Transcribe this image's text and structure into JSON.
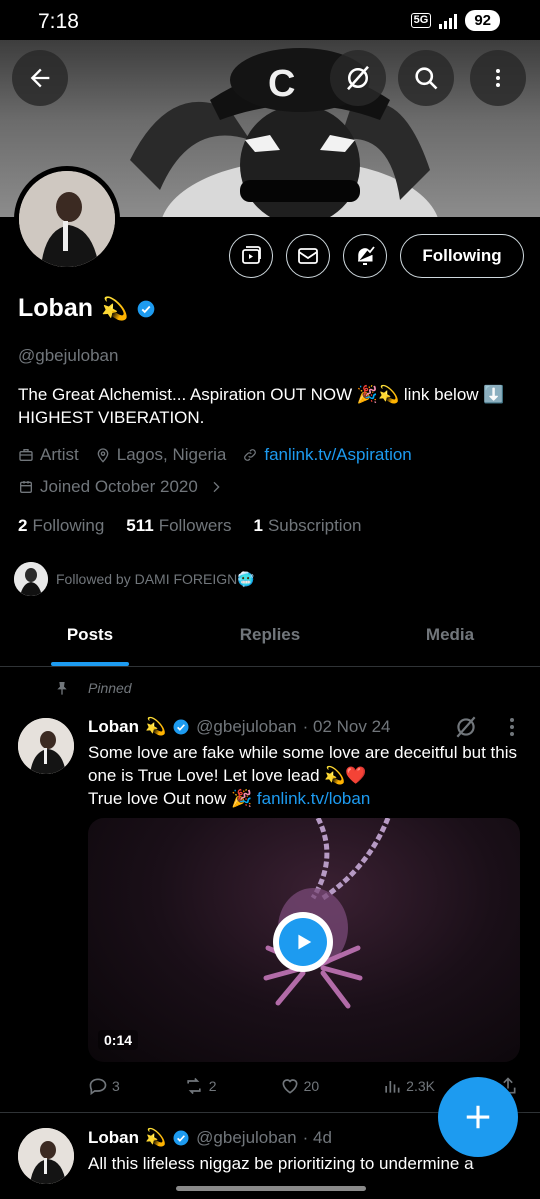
{
  "status": {
    "time": "7:18",
    "network": "5G",
    "battery": "92"
  },
  "profile": {
    "name": "Loban",
    "name_emoji": "💫",
    "handle": "@gbejuloban",
    "bio": "The Great Alchemist... Aspiration OUT NOW 🎉💫 link below ⬇️ HIGHEST VIBERATION.",
    "category": "Artist",
    "location": "Lagos, Nigeria",
    "link": "fanlink.tv/Aspiration",
    "joined": "Joined October 2020",
    "following_count": "2",
    "following_label": "Following",
    "followers_count": "511",
    "followers_label": "Followers",
    "subscription_count": "1",
    "subscription_label": "Subscription",
    "followed_by": "Followed by DAMI FOREIGN🥶",
    "follow_button": "Following"
  },
  "tabs": [
    "Posts",
    "Replies",
    "Media"
  ],
  "pinned_label": "Pinned",
  "tweets": [
    {
      "name": "Loban",
      "emoji": "💫",
      "handle": "@gbejuloban",
      "date": "· 02 Nov 24",
      "text_line1": "Some love are fake while some love are deceitful but this one is True Love!  Let love lead 💫❤️",
      "text_line2": "True love Out now 🎉 ",
      "link": "fanlink.tv/loban",
      "duration": "0:14",
      "replies": "3",
      "reposts": "2",
      "likes": "20",
      "views": "2.3K"
    },
    {
      "name": "Loban",
      "emoji": "💫",
      "handle": "@gbejuloban",
      "date": "· 4d",
      "text": "All this lifeless niggaz be prioritizing to undermine a"
    }
  ],
  "colors": {
    "accent": "#1d9bf0",
    "muted": "#71767b",
    "background": "#000000"
  }
}
